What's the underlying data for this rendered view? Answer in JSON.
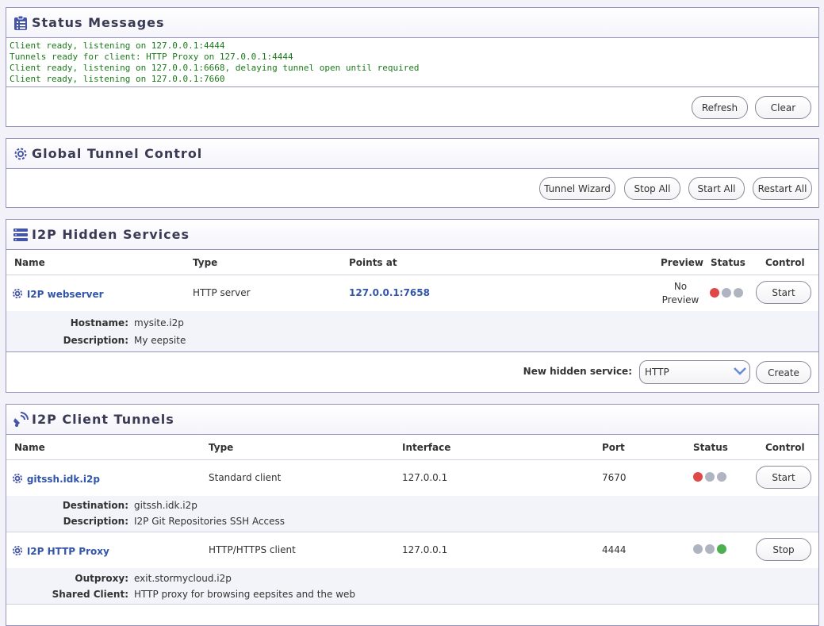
{
  "status": {
    "title": "Status Messages",
    "messages": [
      "Client ready, listening on 127.0.0.1:4444",
      "Tunnels ready for client: HTTP Proxy on 127.0.0.1:4444",
      "Client ready, listening on 127.0.0.1:6668, delaying tunnel open until required",
      "Client ready, listening on 127.0.0.1:7660"
    ],
    "refresh_label": "Refresh",
    "clear_label": "Clear"
  },
  "global": {
    "title": "Global Tunnel Control",
    "wizard_label": "Tunnel Wizard",
    "stop_all_label": "Stop All",
    "start_all_label": "Start All",
    "restart_all_label": "Restart All"
  },
  "hidden": {
    "title": "I2P Hidden Services",
    "headers": {
      "name": "Name",
      "type": "Type",
      "points_at": "Points at",
      "preview": "Preview",
      "status": "Status",
      "control": "Control"
    },
    "services": [
      {
        "name": "I2P webserver",
        "type": "HTTP server",
        "points_at": "127.0.0.1:7658",
        "preview_line1": "No",
        "preview_line2": "Preview",
        "status": [
          "#e04848",
          "#b0b4c0",
          "#b0b4c0"
        ],
        "control_label": "Start",
        "hostname_label": "Hostname:",
        "hostname": "mysite.i2p",
        "description_label": "Description:",
        "description": "My eepsite"
      }
    ],
    "new_label": "New hidden service:",
    "new_value": "HTTP",
    "create_label": "Create"
  },
  "client": {
    "title": "I2P Client Tunnels",
    "headers": {
      "name": "Name",
      "type": "Type",
      "interface": "Interface",
      "port": "Port",
      "status": "Status",
      "control": "Control"
    },
    "tunnels": [
      {
        "name": "gitssh.idk.i2p",
        "type": "Standard client",
        "interface": "127.0.0.1",
        "port": "7670",
        "status": [
          "#e04848",
          "#b0b4c0",
          "#b0b4c0"
        ],
        "control_label": "Start",
        "detail1_label": "Destination:",
        "detail1": "gitssh.idk.i2p",
        "detail2_label": "Description:",
        "detail2": "I2P Git Repositories SSH Access"
      },
      {
        "name": "I2P HTTP Proxy",
        "type": "HTTP/HTTPS client",
        "interface": "127.0.0.1",
        "port": "4444",
        "status": [
          "#b0b4c0",
          "#b0b4c0",
          "#4caf50"
        ],
        "control_label": "Stop",
        "detail1_label": "Outproxy:",
        "detail1": "exit.stormycloud.i2p",
        "detail2_label": "Shared Client:",
        "detail2": "HTTP proxy for browsing eepsites and the web"
      }
    ]
  },
  "colors": {
    "border": "#9494c0",
    "link": "#3355aa",
    "ok": "#4caf50",
    "error": "#e04848",
    "idle": "#b0b4c0",
    "message": "#1a7a1a"
  }
}
